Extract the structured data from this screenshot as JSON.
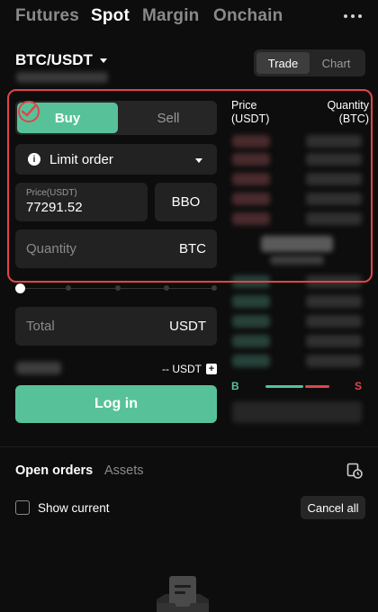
{
  "nav": {
    "tabs": [
      "Futures",
      "Spot",
      "Margin",
      "Onchain"
    ],
    "active_tab": "Spot",
    "more_icon": "more-dots-icon"
  },
  "pair": {
    "symbol": "BTC/USDT",
    "view_toggle": [
      "Trade",
      "Chart"
    ],
    "active_view": "Trade"
  },
  "order_form": {
    "side_buy": "Buy",
    "side_sell": "Sell",
    "active_side": "Buy",
    "order_type": "Limit order",
    "price_label": "Price(USDT)",
    "price_value": "77291.52",
    "bbo_label": "BBO",
    "quantity_placeholder": "Quantity",
    "quantity_unit": "BTC",
    "total_placeholder": "Total",
    "total_unit": "USDT",
    "available": "-- USDT",
    "login_label": "Log in"
  },
  "order_book": {
    "price_header": "Price\n(USDT)",
    "quantity_header": "Quantity\n(BTC)",
    "buy_label": "B",
    "sell_label": "S"
  },
  "orders": {
    "tabs": [
      "Open orders",
      "Assets"
    ],
    "active_tab": "Open orders",
    "show_current_label": "Show current",
    "cancel_all_label": "Cancel all"
  },
  "colors": {
    "buy": "#57c29a",
    "sell": "#e0454a",
    "highlight": "#e0454a",
    "background": "#0d0d0d"
  }
}
